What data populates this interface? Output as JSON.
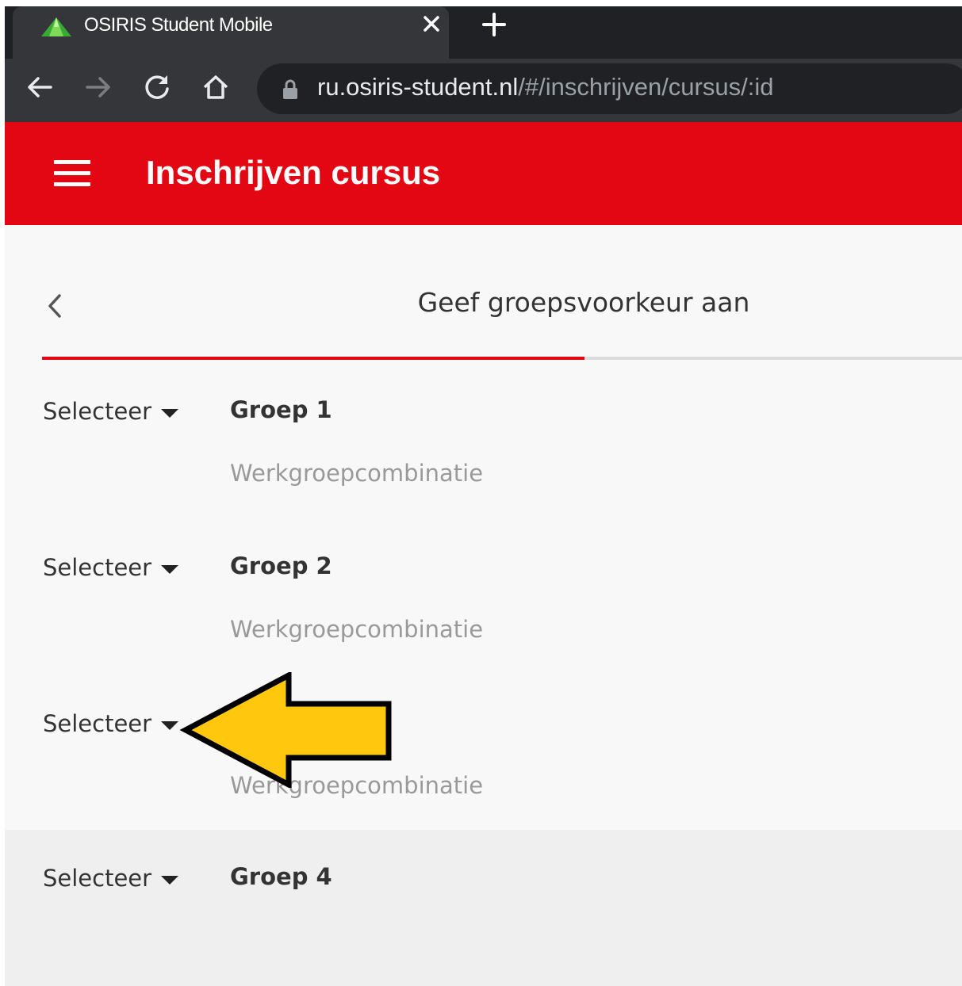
{
  "browser": {
    "tab_title": "OSIRIS Student Mobile",
    "url_host": "ru.osiris-student.nl",
    "url_path": "/#/inschrijven/cursus/:id"
  },
  "appbar": {
    "title": "Inschrijven cursus"
  },
  "step": {
    "title": "Geef groepsvoorkeur aan",
    "progress": 0.59
  },
  "groups": [
    {
      "select_label": "Selecteer",
      "name": "Groep 1",
      "subtitle": "Werkgroepcombinatie"
    },
    {
      "select_label": "Selecteer",
      "name": "Groep 2",
      "subtitle": "Werkgroepcombinatie"
    },
    {
      "select_label": "Selecteer",
      "name": "",
      "subtitle": "Werkgroepcombinatie"
    },
    {
      "select_label": "Selecteer",
      "name": "Groep 4",
      "subtitle": ""
    }
  ],
  "colors": {
    "brand": "#e30613",
    "annotation_arrow": "#ffc80f"
  }
}
